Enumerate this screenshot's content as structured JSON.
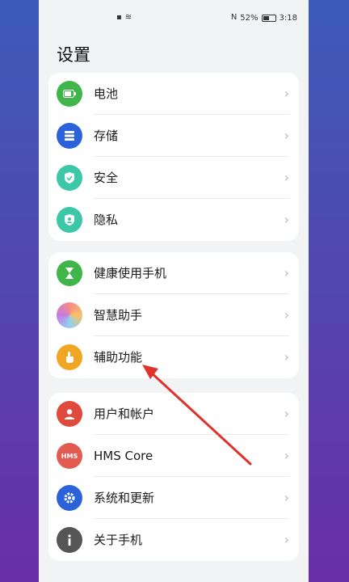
{
  "status": {
    "battery": "52%",
    "time": "3:18"
  },
  "page_title": "设置",
  "groups": [
    [
      {
        "label": "电池",
        "icon": "battery-icon",
        "color": "#3fb54a"
      },
      {
        "label": "存储",
        "icon": "storage-icon",
        "color": "#2b62d8"
      },
      {
        "label": "安全",
        "icon": "shield-icon",
        "color": "#3cc7a6"
      },
      {
        "label": "隐私",
        "icon": "privacy-icon",
        "color": "#3cc7a6"
      }
    ],
    [
      {
        "label": "健康使用手机",
        "icon": "hourglass-icon",
        "color": "#3fb54a"
      },
      {
        "label": "智慧助手",
        "icon": "assistant-icon",
        "color": "#c77be0"
      },
      {
        "label": "辅助功能",
        "icon": "hand-icon",
        "color": "#f0a623"
      }
    ],
    [
      {
        "label": "用户和帐户",
        "icon": "user-icon",
        "color": "#e04a3c"
      },
      {
        "label": "HMS Core",
        "icon": "hms-icon",
        "color": "#e35a50"
      },
      {
        "label": "系统和更新",
        "icon": "gear-icon",
        "color": "#2b62d8"
      },
      {
        "label": "关于手机",
        "icon": "info-icon",
        "color": "#555555"
      }
    ]
  ],
  "hms_badge": "HMS",
  "chevron": "›"
}
